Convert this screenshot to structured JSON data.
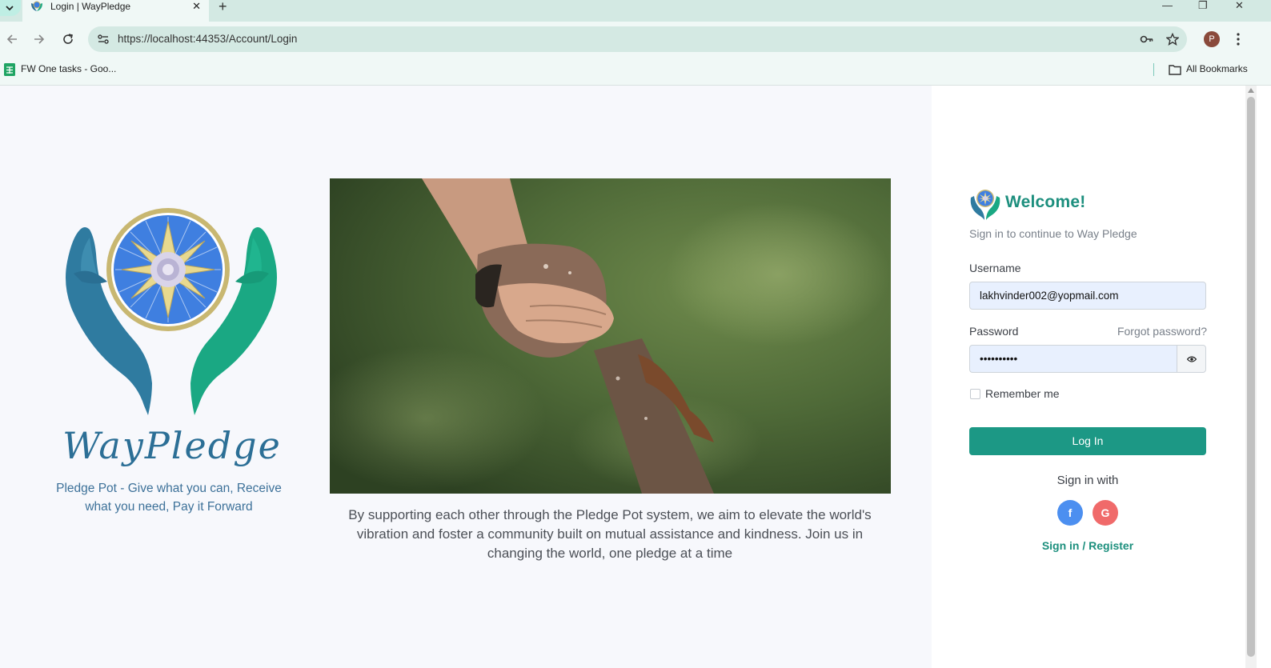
{
  "browser": {
    "tab_title": "Login | WayPledge",
    "new_tab_symbol": "+",
    "close_tab_symbol": "✕",
    "url": "https://localhost:44353/Account/Login",
    "profile_initial": "P",
    "bookmarks": [
      {
        "label": "FW One tasks - Goo...",
        "icon": "google-sheets-icon"
      }
    ],
    "all_bookmarks_label": "All Bookmarks",
    "window_controls": {
      "minimize": "—",
      "restore": "❐",
      "close": "✕"
    }
  },
  "brand": {
    "name": "WayPledge",
    "tagline": "Pledge Pot - Give what you can, Receive what you need, Pay it Forward"
  },
  "hero": {
    "mission_text": "By supporting each other through the Pledge Pot system, we aim to elevate the world's vibration and foster a community built on mutual assistance and kindness. Join us in changing the world, one pledge at a time"
  },
  "login": {
    "title": "Welcome!",
    "subtitle": "Sign in to continue to Way Pledge",
    "username_label": "Username",
    "username_value": "lakhvinder002@yopmail.com",
    "password_label": "Password",
    "password_value": "••••••••••",
    "forgot_password": "Forgot password?",
    "remember_me": "Remember me",
    "login_button": "Log In",
    "sign_in_with": "Sign in with",
    "facebook_letter": "f",
    "google_letter": "G",
    "register_link": "Sign in / Register"
  },
  "colors": {
    "primary": "#1c9885",
    "brand_blue": "#2c6f96",
    "facebook": "#4c8ff0",
    "google": "#f06a6a"
  }
}
